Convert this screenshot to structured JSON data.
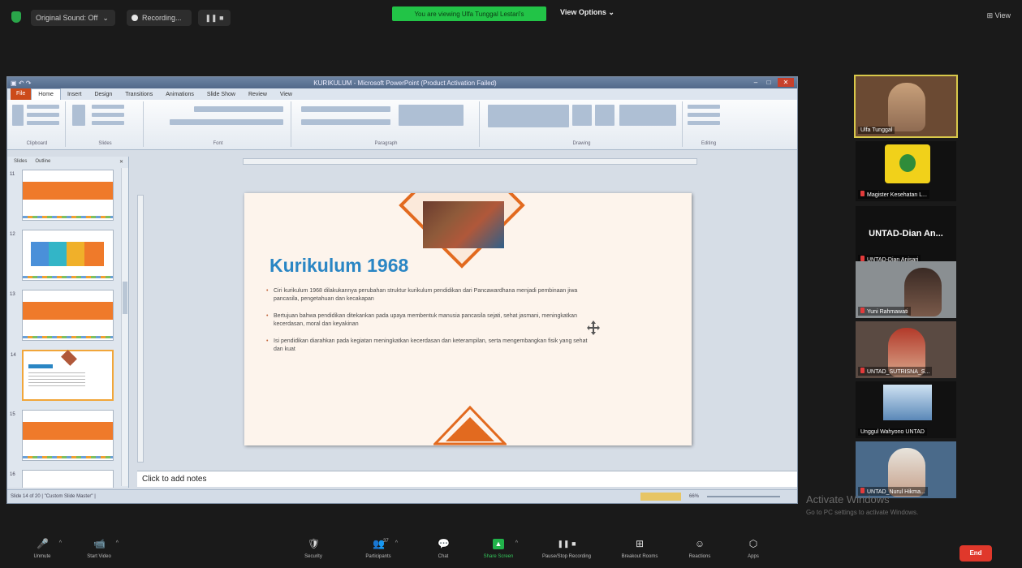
{
  "topbar": {
    "audio_label": "Original Sound: Off",
    "recording_label": "Recording...",
    "pause_stop": "❚❚ ■",
    "viewing_banner": "You are viewing Ulfa Tunggal Lestari's",
    "view_options": "View Options ⌄",
    "view_right": "⊞ View"
  },
  "ppt": {
    "window_title": "KURIKULUM - Microsoft PowerPoint (Product Activation Failed)",
    "tabs": [
      "File",
      "Home",
      "Insert",
      "Design",
      "Transitions",
      "Animations",
      "Slide Show",
      "Review",
      "View"
    ],
    "ribbon_groups": [
      "Clipboard",
      "Slides",
      "Font",
      "Paragraph",
      "Drawing",
      "Editing"
    ],
    "slides_panel_tabs": [
      "Slides",
      "Outline"
    ],
    "thumbnails": [
      {
        "num": "11"
      },
      {
        "num": "12"
      },
      {
        "num": "13"
      },
      {
        "num": "14"
      },
      {
        "num": "15"
      },
      {
        "num": "16"
      }
    ],
    "notes_placeholder": "Click to add notes",
    "status_left": "Slide 14 of 20  |  \"Custom Slide Master\"  |",
    "zoom": "66%"
  },
  "slide": {
    "title": "Kurikulum 1968",
    "bullets": [
      "Ciri kurikulum 1968 dilakukannya perubahan struktur kurikulum pendidikan dari Pancawardhana menjadi pembinaan jiwa pancasila, pengetahuan dan kecakapan",
      "Bertujuan bahwa pendidikan ditekankan pada upaya membentuk manusia pancasila sejati, sehat jasmani, meningkatkan kecerdasan, moral dan keyakinan",
      "Isi pendidikan diarahkan pada kegiatan meningkatkan kecerdasan dan keterampilan, serta mengembangkan fisik yang sehat dan kuat"
    ]
  },
  "participants": [
    {
      "name": "Ulfa Tunggal",
      "type": "video"
    },
    {
      "name": "Magister Kesehatan L...",
      "type": "logo"
    },
    {
      "name": "UNTAD-Dian Anisari",
      "display": "UNTAD-Dian An...",
      "type": "name"
    },
    {
      "name": "Yuni Rahmawati",
      "type": "video"
    },
    {
      "name": "UNTAD_SUTRISNA_S...",
      "type": "video"
    },
    {
      "name": "Unggul Wahyono UNTAD",
      "type": "video"
    },
    {
      "name": "UNTAD_Nurul Hikma...",
      "type": "video"
    }
  ],
  "activate": {
    "title": "Activate Windows",
    "subtitle": "Go to PC settings to activate Windows."
  },
  "bottombar": {
    "buttons": [
      {
        "label": "Unmute",
        "icon": "🎤"
      },
      {
        "label": "Start Video",
        "icon": "📹"
      },
      {
        "label": "Security",
        "icon": "🛡"
      },
      {
        "label": "Participants",
        "icon": "👥",
        "count": "37"
      },
      {
        "label": "Chat",
        "icon": "💬"
      },
      {
        "label": "Share Screen",
        "icon": "▲"
      },
      {
        "label": "Pause/Stop Recording",
        "icon": "❚❚ ■"
      },
      {
        "label": "Breakout Rooms",
        "icon": "⊞"
      },
      {
        "label": "Reactions",
        "icon": "☺"
      },
      {
        "label": "Apps",
        "icon": "⬡"
      }
    ],
    "end_label": "End"
  },
  "colors": {
    "accent_orange": "#e26a1f",
    "title_blue": "#2a86c4",
    "zoom_green": "#22c447",
    "end_red": "#e0382b"
  }
}
